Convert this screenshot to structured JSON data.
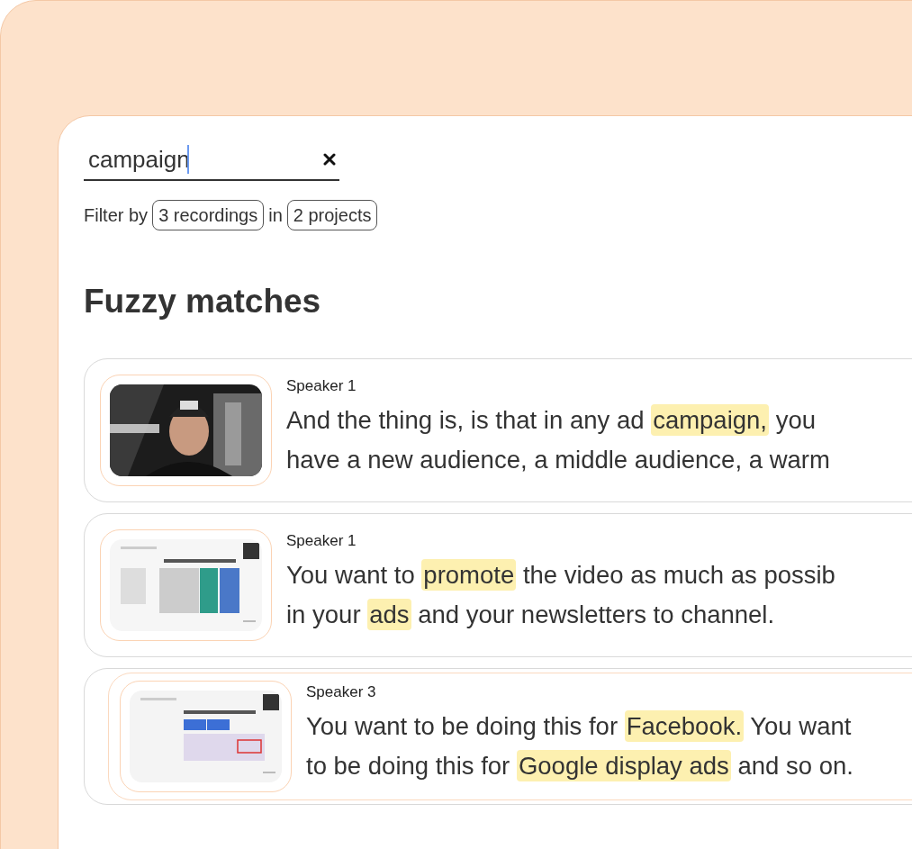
{
  "search": {
    "value": "campaign"
  },
  "filter": {
    "prefix": "Filter by",
    "recordings": "3 recordings",
    "joiner": "in",
    "projects": "2 projects"
  },
  "heading": "Fuzzy matches",
  "matches": [
    {
      "speaker": "Speaker 1",
      "selected": false,
      "thumbnail": {
        "kind": "picture"
      },
      "lines": [
        [
          {
            "text": "And the thing is, is that in any ad ",
            "highlight": false
          },
          {
            "text": "campaign,",
            "highlight": true
          },
          {
            "text": " you",
            "highlight": false
          }
        ],
        [
          {
            "text": "have a new audience, a middle audience, a warm",
            "highlight": false
          }
        ]
      ]
    },
    {
      "speaker": "Speaker 1",
      "selected": false,
      "thumbnail": {
        "kind": "picture"
      },
      "lines": [
        [
          {
            "text": "You want to ",
            "highlight": false
          },
          {
            "text": "promote",
            "highlight": true
          },
          {
            "text": " the video as much as possib",
            "highlight": false
          }
        ],
        [
          {
            "text": "in your ",
            "highlight": false
          },
          {
            "text": "ads",
            "highlight": true
          },
          {
            "text": " and your newsletters to channel.",
            "highlight": false
          }
        ]
      ]
    },
    {
      "speaker": "Speaker 3",
      "selected": true,
      "thumbnail": {
        "kind": "picture"
      },
      "lines": [
        [
          {
            "text": "You want to be doing this for ",
            "highlight": false
          },
          {
            "text": "Facebook.",
            "highlight": true
          },
          {
            "text": " You want",
            "highlight": false
          }
        ],
        [
          {
            "text": "to be doing this for ",
            "highlight": false
          },
          {
            "text": "Google display ads",
            "highlight": true
          },
          {
            "text": " and so on.",
            "highlight": false
          }
        ]
      ]
    }
  ]
}
